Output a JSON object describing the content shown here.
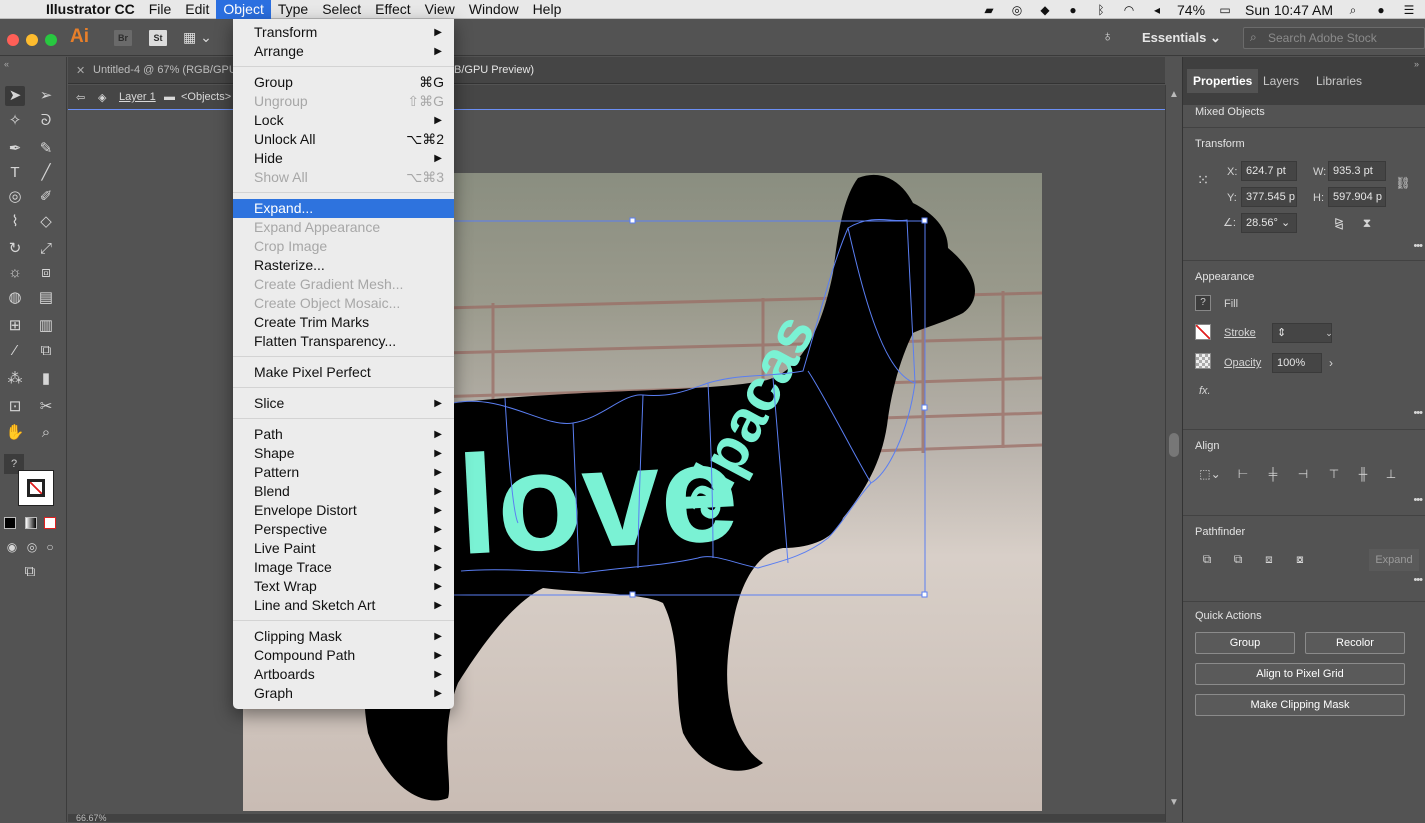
{
  "menubar": {
    "app": "Illustrator CC",
    "items": [
      "File",
      "Edit",
      "Object",
      "Type",
      "Select",
      "Effect",
      "View",
      "Window",
      "Help"
    ],
    "open_index": 2,
    "battery": "74%",
    "clock": "Sun 10:47 AM"
  },
  "appbar": {
    "logo": "Ai",
    "br": "Br",
    "st": "St",
    "workspace": "Essentials",
    "search_placeholder": "Search Adobe Stock"
  },
  "document": {
    "tab_title": "Untitled-4 @ 67% (RGB/GPU",
    "tab_title_tail": "B/GPU Preview)",
    "layer": "Layer 1",
    "context": "<Objects>",
    "zoom": "66.67%"
  },
  "artwork": {
    "word1": "love",
    "word2": "alpacas",
    "fill_color": "#7af2d4",
    "silhouette_color": "#000000",
    "selection_color": "#5a7ef2"
  },
  "object_menu": {
    "items": [
      {
        "label": "Transform",
        "arrow": true
      },
      {
        "label": "Arrange",
        "arrow": true
      },
      {
        "sep": true
      },
      {
        "label": "Group",
        "shortcut": "⌘G"
      },
      {
        "label": "Ungroup",
        "shortcut": "⇧⌘G",
        "disabled": true
      },
      {
        "label": "Lock",
        "arrow": true
      },
      {
        "label": "Unlock All",
        "shortcut": "⌥⌘2"
      },
      {
        "label": "Hide",
        "arrow": true
      },
      {
        "label": "Show All",
        "shortcut": "⌥⌘3",
        "disabled": true
      },
      {
        "sep": true
      },
      {
        "label": "Expand...",
        "highlight": true
      },
      {
        "label": "Expand Appearance",
        "disabled": true
      },
      {
        "label": "Crop Image",
        "disabled": true
      },
      {
        "label": "Rasterize..."
      },
      {
        "label": "Create Gradient Mesh...",
        "disabled": true
      },
      {
        "label": "Create Object Mosaic...",
        "disabled": true
      },
      {
        "label": "Create Trim Marks"
      },
      {
        "label": "Flatten Transparency..."
      },
      {
        "sep": true
      },
      {
        "label": "Make Pixel Perfect"
      },
      {
        "sep": true
      },
      {
        "label": "Slice",
        "arrow": true
      },
      {
        "sep": true
      },
      {
        "label": "Path",
        "arrow": true
      },
      {
        "label": "Shape",
        "arrow": true
      },
      {
        "label": "Pattern",
        "arrow": true
      },
      {
        "label": "Blend",
        "arrow": true
      },
      {
        "label": "Envelope Distort",
        "arrow": true
      },
      {
        "label": "Perspective",
        "arrow": true
      },
      {
        "label": "Live Paint",
        "arrow": true
      },
      {
        "label": "Image Trace",
        "arrow": true
      },
      {
        "label": "Text Wrap",
        "arrow": true
      },
      {
        "label": "Line and Sketch Art",
        "arrow": true
      },
      {
        "sep": true
      },
      {
        "label": "Clipping Mask",
        "arrow": true
      },
      {
        "label": "Compound Path",
        "arrow": true
      },
      {
        "label": "Artboards",
        "arrow": true
      },
      {
        "label": "Graph",
        "arrow": true
      }
    ]
  },
  "panel": {
    "tabs": [
      "Properties",
      "Layers",
      "Libraries"
    ],
    "selection_type": "Mixed Objects",
    "transform": {
      "title": "Transform",
      "x_label": "X:",
      "x": "624.7 pt",
      "y_label": "Y:",
      "y": "377.545 p",
      "w_label": "W:",
      "w": "935.3 pt",
      "h_label": "H:",
      "h": "597.904 p",
      "angle": "28.56°"
    },
    "appearance": {
      "title": "Appearance",
      "fill": "Fill",
      "stroke": "Stroke",
      "opacity_label": "Opacity",
      "opacity": "100%",
      "fx": "fx."
    },
    "align_title": "Align",
    "pathfinder_title": "Pathfinder",
    "pathfinder_expand": "Expand",
    "quick_actions": {
      "title": "Quick Actions",
      "group": "Group",
      "recolor": "Recolor",
      "align_pixel": "Align to Pixel Grid",
      "clipping": "Make Clipping Mask"
    }
  }
}
